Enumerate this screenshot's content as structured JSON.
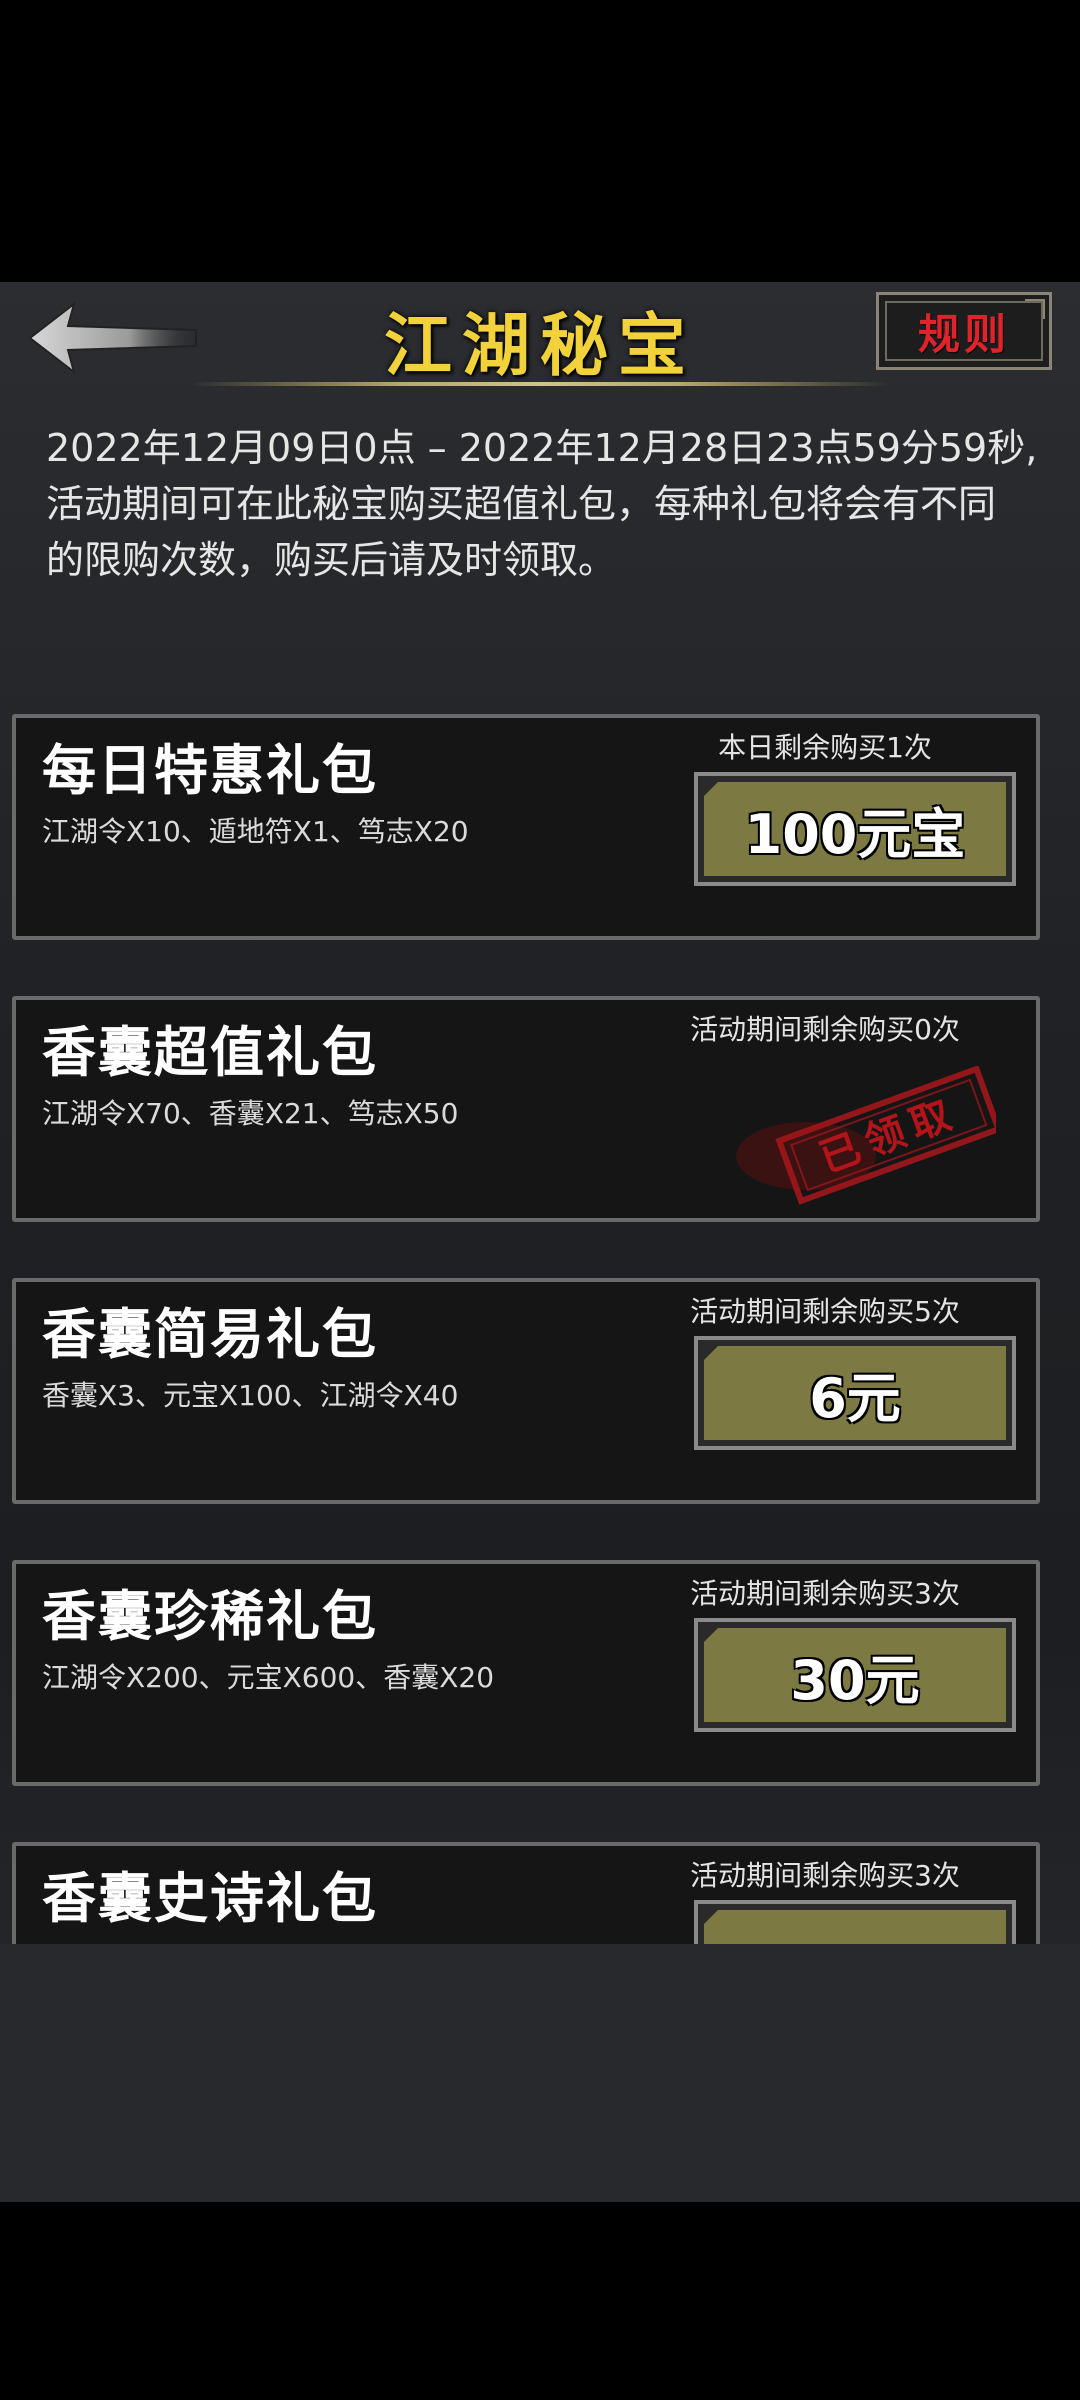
{
  "header": {
    "title": "江湖秘宝",
    "rules_label": "规则"
  },
  "description": {
    "line1": "2022年12月09日0点 – 2022年12月28日23点59分59秒,",
    "line2": "活动期间可在此秘宝购买超值礼包，每种礼包将会有不同",
    "line3": "的限购次数，购买后请及时领取。"
  },
  "packages": [
    {
      "title": "每日特惠礼包",
      "items": "江湖令X10、遁地符X1、笃志X20",
      "limit": "本日剩余购买1次",
      "button": "100元宝"
    },
    {
      "title": "香囊超值礼包",
      "items": "江湖令X70、香囊X21、笃志X50",
      "limit": "活动期间剩余购买0次",
      "stamp": "已领取"
    },
    {
      "title": "香囊简易礼包",
      "items": "香囊X3、元宝X100、江湖令X40",
      "limit": "活动期间剩余购买5次",
      "button": "6元"
    },
    {
      "title": "香囊珍稀礼包",
      "items": "江湖令X200、元宝X600、香囊X20",
      "limit": "活动期间剩余购买3次",
      "button": "30元"
    },
    {
      "title": "香囊史诗礼包",
      "limit": "活动期间剩余购买3次"
    }
  ]
}
